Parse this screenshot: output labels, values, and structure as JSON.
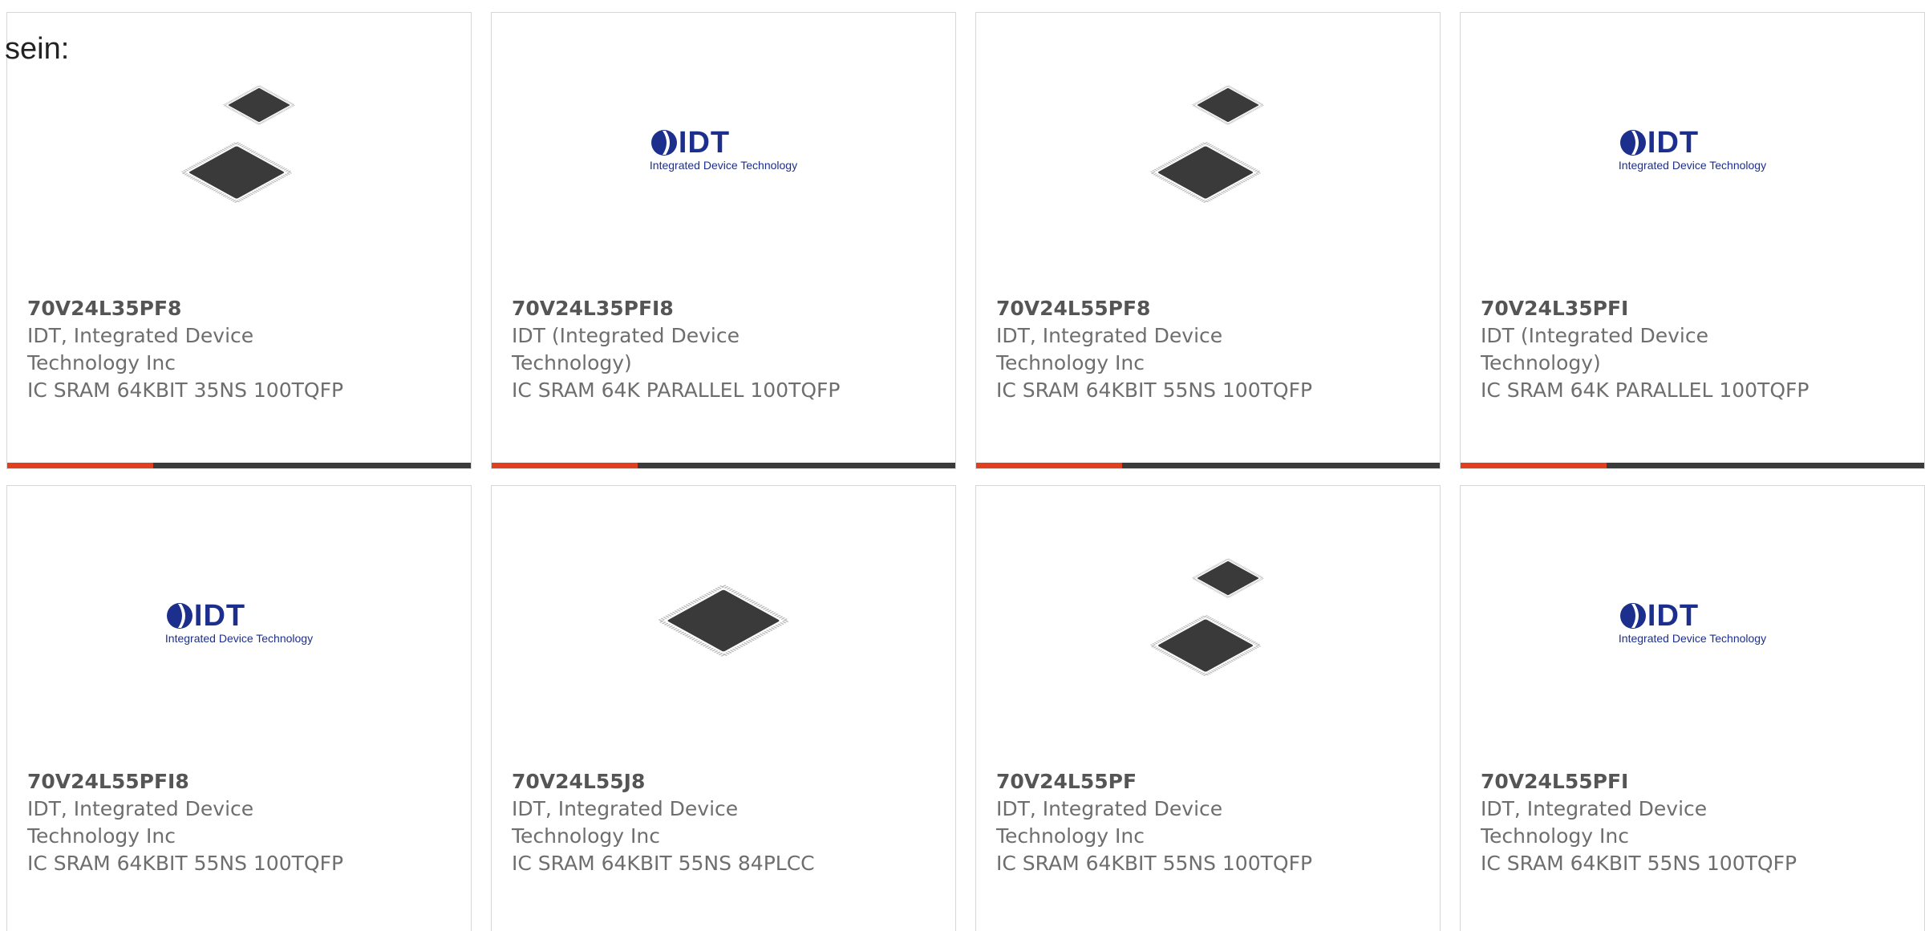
{
  "intro_text": "sein:",
  "colors": {
    "accent": "#e0401f",
    "bar": "#3b3b3b",
    "logo_blue": "#1c2f8c"
  },
  "products": [
    {
      "part": "70V24L35PF8",
      "maker_line1": "IDT, Integrated Device",
      "maker_line2": "Technology Inc",
      "description": "IC SRAM 64KBIT 35NS 100TQFP",
      "image": "chip-tqfp-pair"
    },
    {
      "part": "70V24L35PFI8",
      "maker_line1": "IDT (Integrated Device",
      "maker_line2": "Technology)",
      "description": "IC SRAM 64K PARALLEL 100TQFP",
      "image": "idt-logo"
    },
    {
      "part": "70V24L55PF8",
      "maker_line1": "IDT, Integrated Device",
      "maker_line2": "Technology Inc",
      "description": "IC SRAM 64KBIT 55NS 100TQFP",
      "image": "chip-tqfp-pair"
    },
    {
      "part": "70V24L35PFI",
      "maker_line1": "IDT (Integrated Device",
      "maker_line2": "Technology)",
      "description": "IC SRAM 64K PARALLEL 100TQFP",
      "image": "idt-logo"
    },
    {
      "part": "70V24L55PFI8",
      "maker_line1": "IDT, Integrated Device",
      "maker_line2": "Technology Inc",
      "description": "IC SRAM 64KBIT 55NS 100TQFP",
      "image": "idt-logo"
    },
    {
      "part": "70V24L55J8",
      "maker_line1": "IDT, Integrated Device",
      "maker_line2": "Technology Inc",
      "description": "IC SRAM 64KBIT 55NS 84PLCC",
      "image": "chip-plcc"
    },
    {
      "part": "70V24L55PF",
      "maker_line1": "IDT, Integrated Device",
      "maker_line2": "Technology Inc",
      "description": "IC SRAM 64KBIT 55NS 100TQFP",
      "image": "chip-tqfp-pair"
    },
    {
      "part": "70V24L55PFI",
      "maker_line1": "IDT, Integrated Device",
      "maker_line2": "Technology Inc",
      "description": "IC SRAM 64KBIT 55NS 100TQFP",
      "image": "idt-logo"
    }
  ],
  "logo": {
    "wordmark": "IDT",
    "tagline": "Integrated Device Technology"
  }
}
